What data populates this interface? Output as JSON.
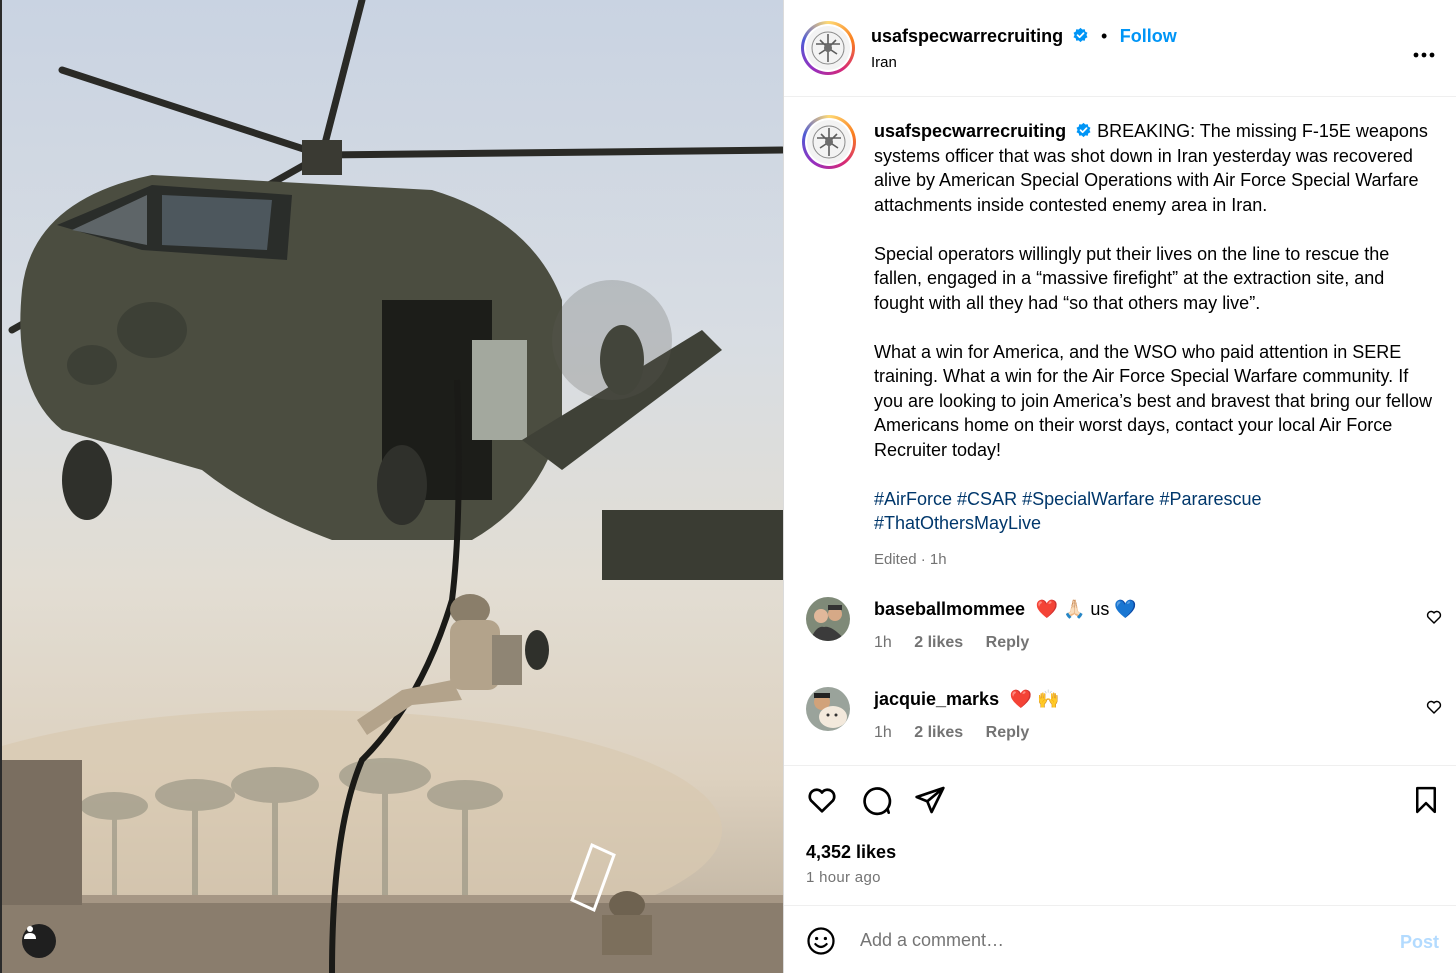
{
  "post": {
    "username": "usafspecwarrecruiting",
    "follow_label": "Follow",
    "separator": "•",
    "location": "Iran",
    "more_label": "•••"
  },
  "caption": {
    "username": "usafspecwarrecruiting",
    "paragraph1": "BREAKING: The missing F-15E weapons systems officer that was shot down in Iran yesterday was recovered alive by American Special Operations with Air Force Special Warfare attachments inside contested enemy area in Iran.",
    "paragraph2": "Special operators willingly put their lives on the line to rescue the fallen, engaged in a “massive firefight” at the extraction site, and fought with all they had “so that others may live”.",
    "paragraph3": "What a win for America, and the WSO who paid attention in SERE training. What a win for the Air Force Special Warfare community. If you are looking to join America’s best and bravest that bring our fellow Americans home on their worst days, contact your local Air Force Recruiter today!",
    "hashtags": [
      "#AirForce",
      "#CSAR",
      "#SpecialWarfare",
      "#Pararescue",
      "#ThatOthersMayLive"
    ],
    "edited": "Edited · 1h"
  },
  "comments": [
    {
      "user": "baseballmommee",
      "text": "❤️ 🙏🏻 us 💙",
      "time": "1h",
      "likes": "2 likes",
      "reply": "Reply"
    },
    {
      "user": "jacquie_marks",
      "text": "❤️ 🙌",
      "time": "1h",
      "likes": "2 likes",
      "reply": "Reply"
    }
  ],
  "actions": {
    "likes": "4,352 likes",
    "time": "1 hour ago"
  },
  "composer": {
    "placeholder": "Add a comment…",
    "post_label": "Post"
  },
  "icons": {
    "like": "heart-icon",
    "comment": "comment-bubble-icon",
    "share": "paper-plane-icon",
    "save": "bookmark-icon",
    "emoji": "emoji-smile-icon",
    "tag": "user-tag-icon",
    "verified": "verified-badge-icon"
  },
  "colors": {
    "link": "#0095f6",
    "hashtag": "#00376b",
    "muted": "#737373",
    "post_disabled": "#b3dbff"
  }
}
